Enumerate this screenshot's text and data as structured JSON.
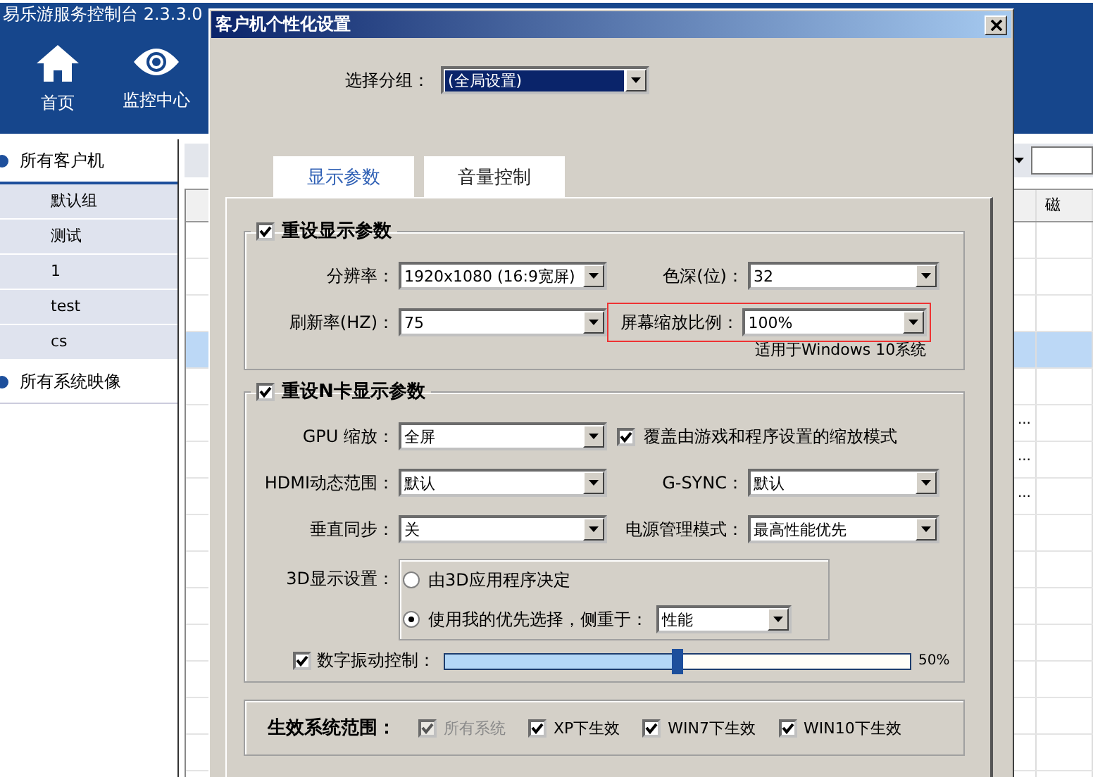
{
  "app": {
    "title": "易乐游服务控制台 2.3.3.0",
    "nav": [
      {
        "label": "首页"
      },
      {
        "label": "监控中心"
      }
    ]
  },
  "sidebar": {
    "groups": [
      {
        "label": "所有客户机",
        "expanded": true,
        "children": [
          {
            "label": "默认组"
          },
          {
            "label": "测试"
          },
          {
            "label": "1"
          },
          {
            "label": "test"
          },
          {
            "label": "cs"
          }
        ]
      },
      {
        "label": "所有系统映像",
        "expanded": false
      }
    ]
  },
  "table": {
    "columns": [
      "磁"
    ],
    "rows": [
      {
        "selected": false
      },
      {
        "selected": false
      },
      {
        "selected": false
      },
      {
        "selected": true
      },
      {
        "selected": false
      },
      {
        "selected": false,
        "column_1": "..."
      },
      {
        "selected": false,
        "column_1": "..."
      },
      {
        "selected": false,
        "column_1": "..."
      },
      {
        "selected": false
      },
      {
        "selected": false
      },
      {
        "selected": false
      },
      {
        "selected": false
      },
      {
        "selected": false
      },
      {
        "selected": false
      },
      {
        "selected": false
      },
      {
        "selected": false
      }
    ]
  },
  "dialog": {
    "title": "客户机个性化设置",
    "group_select": {
      "label": "选择分组：",
      "value": "(全局设置)"
    },
    "tabs": [
      {
        "label": "显示参数",
        "selected": true
      },
      {
        "label": "音量控制",
        "selected": false
      }
    ],
    "display": {
      "label": "重设显示参数",
      "checked": true,
      "fields": [
        {
          "label": "分辨率：",
          "value": "1920x1080 (16:9宽屏)",
          "highlighted": false
        },
        {
          "label": "色深(位)：",
          "value": "32",
          "highlighted": false
        },
        {
          "label": "刷新率(HZ)：",
          "value": "75",
          "highlighted": false
        },
        {
          "label": "屏幕缩放比例：",
          "value": "100%",
          "highlighted": true
        }
      ],
      "note": "适用于Windows 10系统"
    },
    "nvidia": {
      "label": "重设N卡显示参数",
      "checked": true,
      "items": [
        {
          "kind": "combo",
          "label": "GPU 缩放：",
          "value": "全屏"
        },
        {
          "kind": "checkbox",
          "label": "覆盖由游戏和程序设置的缩放模式",
          "checked": true
        },
        {
          "kind": "combo",
          "label": "HDMI动态范围：",
          "value": "默认"
        },
        {
          "kind": "combo",
          "label": "G-SYNC：",
          "value": "默认"
        },
        {
          "kind": "combo",
          "label": "垂直同步：",
          "value": "关"
        },
        {
          "kind": "combo",
          "label": "电源管理模式：",
          "value": "最高性能优先"
        }
      ],
      "mode_3d": {
        "label": "3D显示设置：",
        "options": [
          {
            "label": "由3D应用程序决定",
            "selected": false
          },
          {
            "label": "使用我的优先选择，侧重于：",
            "selected": true
          }
        ],
        "focus": "性能"
      },
      "vibrance": {
        "label": "数字振动控制：",
        "checked": true,
        "level": 0.5,
        "reading": "50%"
      }
    },
    "scope": {
      "label": "生效系统范围：",
      "options": [
        {
          "label": "所有系统",
          "checked": true,
          "disabled": true
        },
        {
          "label": "XP下生效",
          "checked": true,
          "disabled": false
        },
        {
          "label": "WIN7下生效",
          "checked": true,
          "disabled": false
        },
        {
          "label": "WIN10下生效",
          "checked": true,
          "disabled": false
        }
      ]
    }
  }
}
